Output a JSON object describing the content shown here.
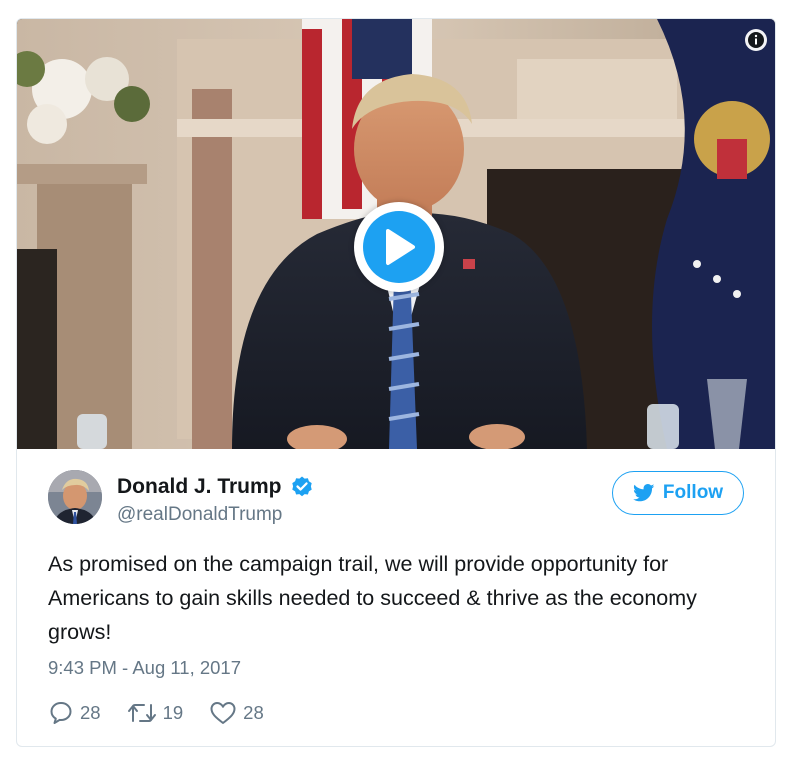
{
  "tweet": {
    "author_name": "Donald J. Trump",
    "handle": "@realDonaldTrump",
    "verified_icon": "verified-badge-icon",
    "follow_label": "Follow",
    "text": "As promised on the campaign trail, we will provide opportunity for Americans to gain skills needed to succeed & thrive as the economy grows!",
    "timestamp": "9:43 PM - Aug 11, 2017",
    "stats": {
      "replies": "28",
      "retweets": "19",
      "likes": "28"
    }
  },
  "media": {
    "type": "video",
    "play_icon": "play-icon",
    "info_icon": "info-icon"
  },
  "colors": {
    "accent": "#1da1f2",
    "text": "#14171a",
    "secondary": "#657786",
    "border": "#e1e8ed"
  }
}
